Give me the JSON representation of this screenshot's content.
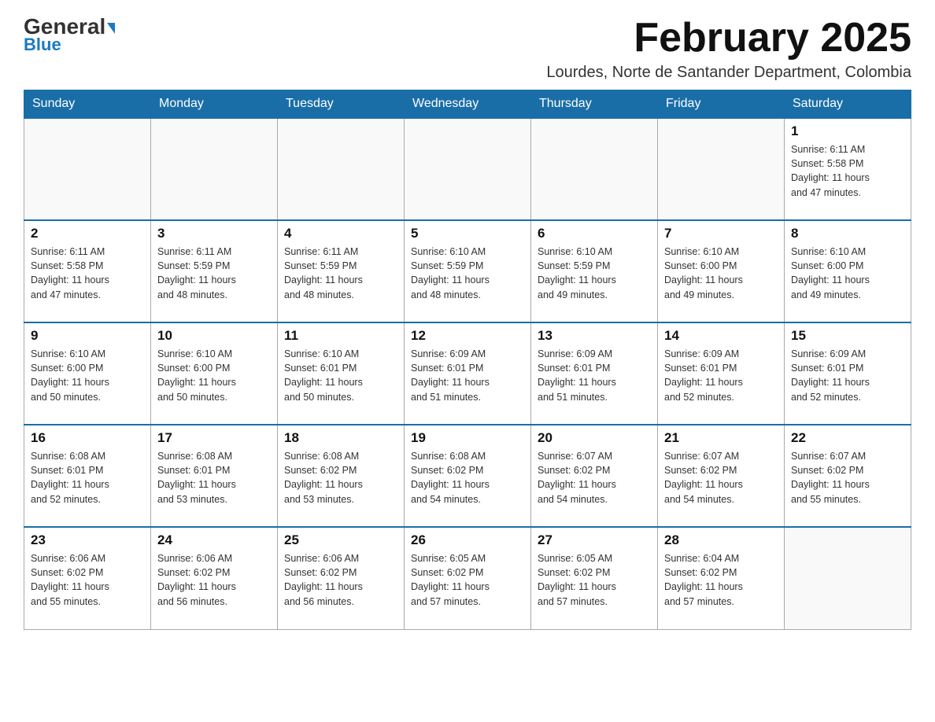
{
  "header": {
    "logo_general": "General",
    "logo_blue": "Blue",
    "month_title": "February 2025",
    "subtitle": "Lourdes, Norte de Santander Department, Colombia"
  },
  "weekdays": [
    "Sunday",
    "Monday",
    "Tuesday",
    "Wednesday",
    "Thursday",
    "Friday",
    "Saturday"
  ],
  "weeks": [
    [
      {
        "day": "",
        "info": ""
      },
      {
        "day": "",
        "info": ""
      },
      {
        "day": "",
        "info": ""
      },
      {
        "day": "",
        "info": ""
      },
      {
        "day": "",
        "info": ""
      },
      {
        "day": "",
        "info": ""
      },
      {
        "day": "1",
        "info": "Sunrise: 6:11 AM\nSunset: 5:58 PM\nDaylight: 11 hours\nand 47 minutes."
      }
    ],
    [
      {
        "day": "2",
        "info": "Sunrise: 6:11 AM\nSunset: 5:58 PM\nDaylight: 11 hours\nand 47 minutes."
      },
      {
        "day": "3",
        "info": "Sunrise: 6:11 AM\nSunset: 5:59 PM\nDaylight: 11 hours\nand 48 minutes."
      },
      {
        "day": "4",
        "info": "Sunrise: 6:11 AM\nSunset: 5:59 PM\nDaylight: 11 hours\nand 48 minutes."
      },
      {
        "day": "5",
        "info": "Sunrise: 6:10 AM\nSunset: 5:59 PM\nDaylight: 11 hours\nand 48 minutes."
      },
      {
        "day": "6",
        "info": "Sunrise: 6:10 AM\nSunset: 5:59 PM\nDaylight: 11 hours\nand 49 minutes."
      },
      {
        "day": "7",
        "info": "Sunrise: 6:10 AM\nSunset: 6:00 PM\nDaylight: 11 hours\nand 49 minutes."
      },
      {
        "day": "8",
        "info": "Sunrise: 6:10 AM\nSunset: 6:00 PM\nDaylight: 11 hours\nand 49 minutes."
      }
    ],
    [
      {
        "day": "9",
        "info": "Sunrise: 6:10 AM\nSunset: 6:00 PM\nDaylight: 11 hours\nand 50 minutes."
      },
      {
        "day": "10",
        "info": "Sunrise: 6:10 AM\nSunset: 6:00 PM\nDaylight: 11 hours\nand 50 minutes."
      },
      {
        "day": "11",
        "info": "Sunrise: 6:10 AM\nSunset: 6:01 PM\nDaylight: 11 hours\nand 50 minutes."
      },
      {
        "day": "12",
        "info": "Sunrise: 6:09 AM\nSunset: 6:01 PM\nDaylight: 11 hours\nand 51 minutes."
      },
      {
        "day": "13",
        "info": "Sunrise: 6:09 AM\nSunset: 6:01 PM\nDaylight: 11 hours\nand 51 minutes."
      },
      {
        "day": "14",
        "info": "Sunrise: 6:09 AM\nSunset: 6:01 PM\nDaylight: 11 hours\nand 52 minutes."
      },
      {
        "day": "15",
        "info": "Sunrise: 6:09 AM\nSunset: 6:01 PM\nDaylight: 11 hours\nand 52 minutes."
      }
    ],
    [
      {
        "day": "16",
        "info": "Sunrise: 6:08 AM\nSunset: 6:01 PM\nDaylight: 11 hours\nand 52 minutes."
      },
      {
        "day": "17",
        "info": "Sunrise: 6:08 AM\nSunset: 6:01 PM\nDaylight: 11 hours\nand 53 minutes."
      },
      {
        "day": "18",
        "info": "Sunrise: 6:08 AM\nSunset: 6:02 PM\nDaylight: 11 hours\nand 53 minutes."
      },
      {
        "day": "19",
        "info": "Sunrise: 6:08 AM\nSunset: 6:02 PM\nDaylight: 11 hours\nand 54 minutes."
      },
      {
        "day": "20",
        "info": "Sunrise: 6:07 AM\nSunset: 6:02 PM\nDaylight: 11 hours\nand 54 minutes."
      },
      {
        "day": "21",
        "info": "Sunrise: 6:07 AM\nSunset: 6:02 PM\nDaylight: 11 hours\nand 54 minutes."
      },
      {
        "day": "22",
        "info": "Sunrise: 6:07 AM\nSunset: 6:02 PM\nDaylight: 11 hours\nand 55 minutes."
      }
    ],
    [
      {
        "day": "23",
        "info": "Sunrise: 6:06 AM\nSunset: 6:02 PM\nDaylight: 11 hours\nand 55 minutes."
      },
      {
        "day": "24",
        "info": "Sunrise: 6:06 AM\nSunset: 6:02 PM\nDaylight: 11 hours\nand 56 minutes."
      },
      {
        "day": "25",
        "info": "Sunrise: 6:06 AM\nSunset: 6:02 PM\nDaylight: 11 hours\nand 56 minutes."
      },
      {
        "day": "26",
        "info": "Sunrise: 6:05 AM\nSunset: 6:02 PM\nDaylight: 11 hours\nand 57 minutes."
      },
      {
        "day": "27",
        "info": "Sunrise: 6:05 AM\nSunset: 6:02 PM\nDaylight: 11 hours\nand 57 minutes."
      },
      {
        "day": "28",
        "info": "Sunrise: 6:04 AM\nSunset: 6:02 PM\nDaylight: 11 hours\nand 57 minutes."
      },
      {
        "day": "",
        "info": ""
      }
    ]
  ]
}
